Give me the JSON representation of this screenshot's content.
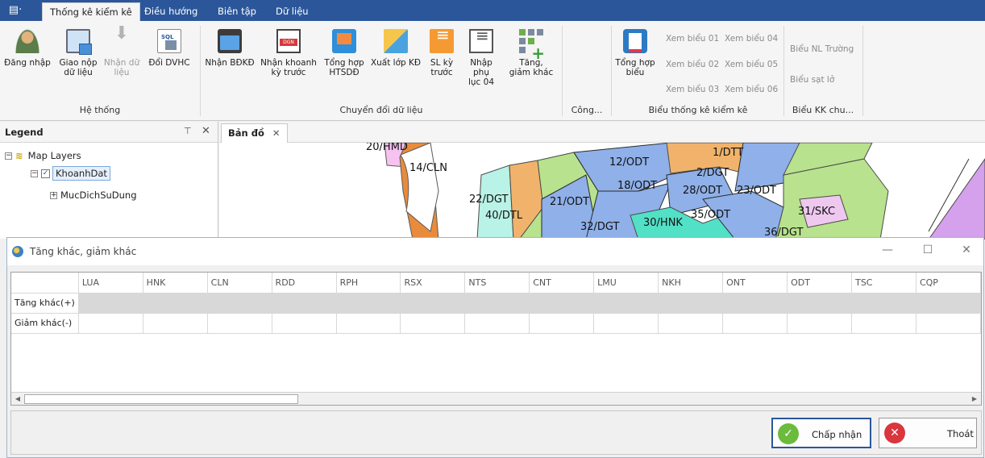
{
  "ribbon": {
    "app_menu_icon": "app-menu-icon",
    "tabs": [
      {
        "label": "Thống kê kiểm kê",
        "active": true
      },
      {
        "label": "Điều hướng",
        "active": false
      },
      {
        "label": "Biên tập",
        "active": false
      },
      {
        "label": "Dữ liệu",
        "active": false
      }
    ],
    "he_thong": {
      "label": "Hệ thống",
      "buttons": [
        {
          "label": "Đăng nhập",
          "icon": "user-login-icon"
        },
        {
          "label1": "Giao nộp",
          "label2": "dữ liệu",
          "icon": "submit-data-icon"
        },
        {
          "label1": "Nhận dữ",
          "label2": "liệu",
          "icon": "receive-data-icon",
          "disabled": true
        },
        {
          "label": "Đổi DVHC",
          "icon": "sql-database-icon"
        }
      ]
    },
    "chuyen_doi": {
      "label": "Chuyển đổi dữ liệu",
      "buttons": [
        {
          "label": "Nhận BĐKĐ",
          "icon": "folder-map-icon"
        },
        {
          "label1": "Nhận khoanh",
          "label2": "kỳ trước",
          "icon": "dgn-file-icon"
        },
        {
          "label1": "Tổng hợp",
          "label2": "HTSDĐ",
          "icon": "computer-icon"
        },
        {
          "label": "Xuất lớp KĐ",
          "icon": "export-layer-icon"
        },
        {
          "label1": "SL kỳ",
          "label2": "trước",
          "icon": "list-icon"
        },
        {
          "label1": "Nhập phụ",
          "label2": "lục 04",
          "icon": "document-icon"
        },
        {
          "label1": "Tăng,",
          "label2": "giảm khác",
          "icon": "grid-add-icon"
        }
      ]
    },
    "cong": {
      "label": "Công..."
    },
    "bieu_thong_ke": {
      "label": "Biểu thống kê kiểm kê",
      "tong_hop": {
        "label1": "Tổng hợp",
        "label2": "biểu",
        "icon": "report-icon"
      },
      "links": [
        "Xem biểu 01",
        "Xem biểu 04",
        "Xem biểu 02",
        "Xem biểu 05",
        "Xem biểu 03",
        "Xem biểu 06"
      ]
    },
    "bieu_kk": {
      "label": "Biểu KK chu...",
      "links": [
        "Biểu NL Trường",
        "Biểu sạt lở"
      ]
    }
  },
  "legend": {
    "title": "Legend",
    "pin_icon": "pin-icon",
    "close_icon": "close-icon",
    "root": "Map Layers",
    "layer": "KhoanhDat",
    "sublayer": "MucDichSuDung"
  },
  "map": {
    "tab_label": "Bản đồ",
    "labels": [
      "20/HMD",
      "14/CLN",
      "22/DGT",
      "40/DTL",
      "21/ODT",
      "12/ODT",
      "18/ODT",
      "1/DTT",
      "2/DGT",
      "28/ODT",
      "23/ODT",
      "35/ODT",
      "30/HNK",
      "32/DGT",
      "31/SKC",
      "36/DGT"
    ]
  },
  "dialog": {
    "title": "Tăng khác, giảm khác",
    "columns": [
      "",
      "LUA",
      "HNK",
      "CLN",
      "RDD",
      "RPH",
      "RSX",
      "NTS",
      "CNT",
      "LMU",
      "NKH",
      "ONT",
      "ODT",
      "TSC",
      "CQP"
    ],
    "rows": [
      {
        "label": "Tăng khác(+)"
      },
      {
        "label": "Giảm khác(-)"
      }
    ],
    "ok_label": "Chấp nhận",
    "cancel_label": "Thoát"
  },
  "colors": {
    "ribbon_bar": "#2b579a",
    "map_blue": "#8fb0e8",
    "map_orange": "#f1b36b",
    "map_teal": "#52e0c6",
    "map_green": "#b8e28d"
  }
}
